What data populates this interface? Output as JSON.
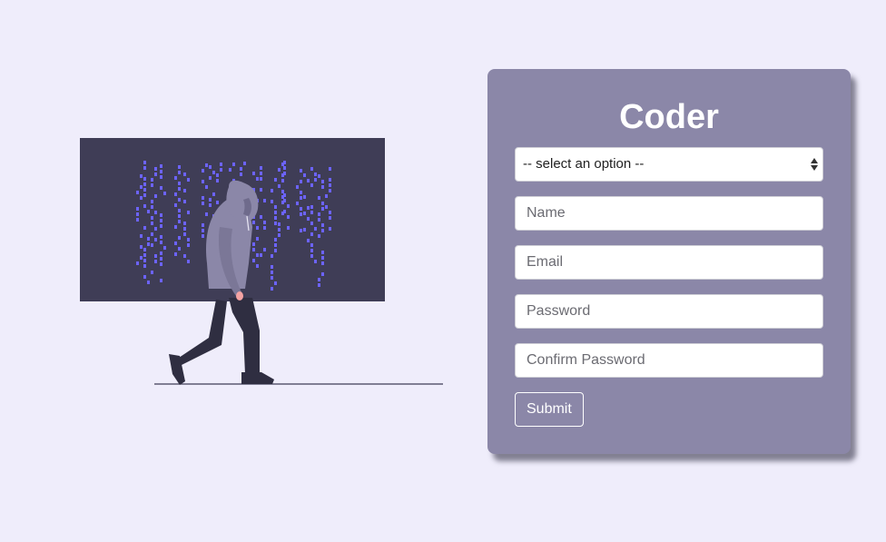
{
  "form": {
    "title": "Coder",
    "select": {
      "selected": "-- select an option --"
    },
    "name_placeholder": "Name",
    "email_placeholder": "Email",
    "password_placeholder": "Password",
    "confirm_password_placeholder": "Confirm Password",
    "submit_label": "Submit"
  },
  "colors": {
    "page_background": "#efedfb",
    "card_background": "#8b87a8",
    "screen_dark": "#3f3d56",
    "matrix_glyph": "#6c63ff",
    "hoodie": "#8b87a8",
    "pants": "#2f2e41"
  }
}
